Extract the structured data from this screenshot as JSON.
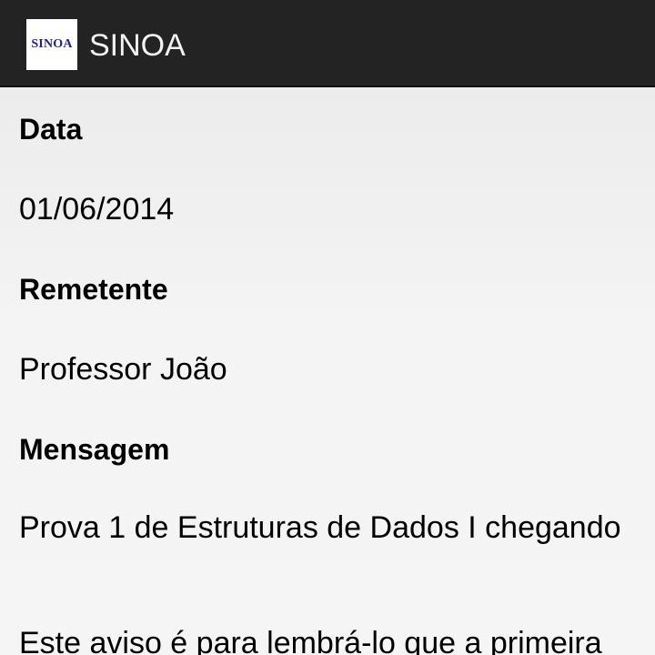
{
  "app": {
    "logo_text": "SINOA",
    "title": "SINOA"
  },
  "fields": {
    "date_label": "Data",
    "date_value": "01/06/2014",
    "sender_label": "Remetente",
    "sender_value": "Professor João",
    "message_label": "Mensagem",
    "message_subject": "Prova 1 de Estruturas de Dados I chegando",
    "message_body": "Este aviso é para lembrá-lo que a primeira"
  },
  "colors": {
    "action_bar": "#232323",
    "logo_text": "#1f1f8f"
  }
}
